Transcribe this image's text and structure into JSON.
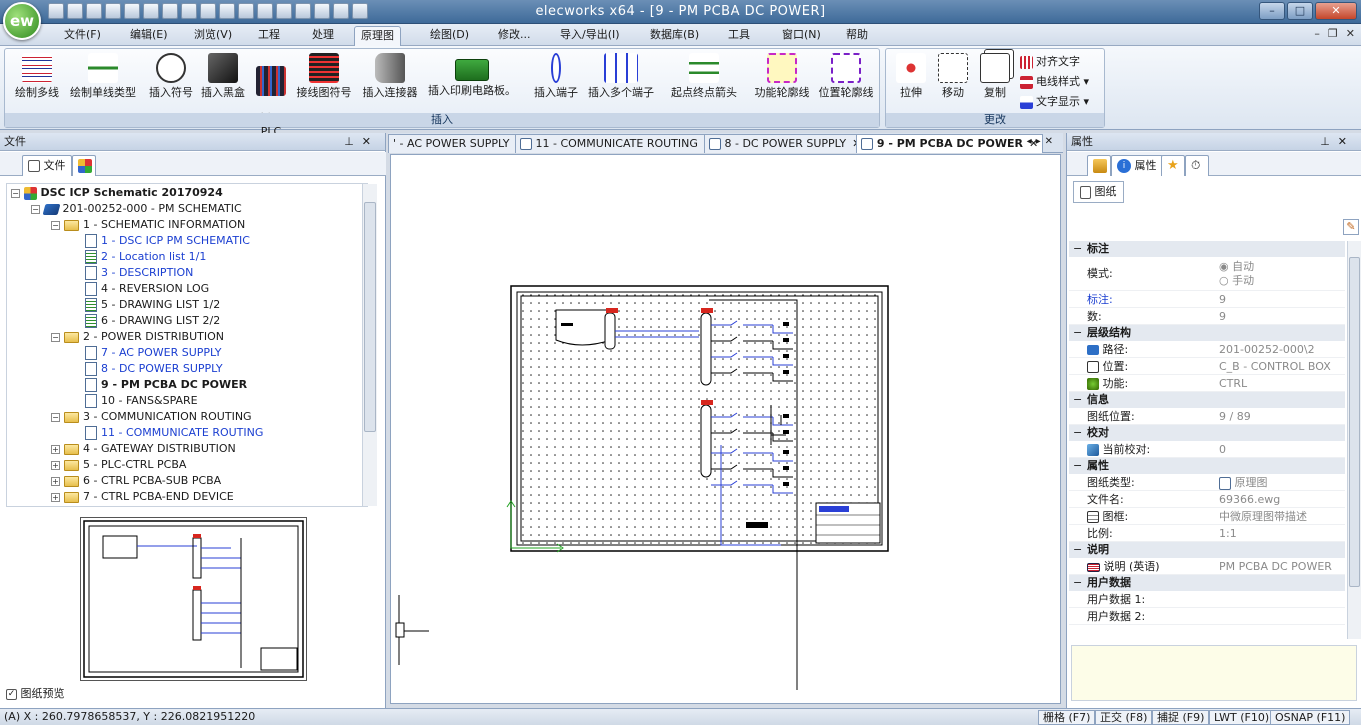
{
  "app": {
    "logo": "ew",
    "title": "elecworks x64 - [9 - PM PCBA DC POWER]"
  },
  "menu": [
    {
      "label": "文件(F)"
    },
    {
      "label": "编辑(E)"
    },
    {
      "label": "浏览(V)"
    },
    {
      "label": "工程"
    },
    {
      "label": "处理"
    },
    {
      "label": "原理图"
    },
    {
      "label": "绘图(D)"
    },
    {
      "label": "修改..."
    },
    {
      "label": "导入/导出(I)"
    },
    {
      "label": "数据库(B)"
    },
    {
      "label": "工具"
    },
    {
      "label": "窗口(N)"
    },
    {
      "label": "帮助"
    }
  ],
  "ribbon": {
    "insert_group": "插入",
    "modify_group": "更改",
    "buttons": [
      {
        "label": "绘制多线",
        "icon": "multiwire-icon"
      },
      {
        "label": "绘制单线类型",
        "icon": "single-wire-icon"
      },
      {
        "label": "插入符号",
        "icon": "motor-symbol-icon"
      },
      {
        "label": "插入黑盒",
        "icon": "black-box-icon"
      },
      {
        "label": "插入\nPLC",
        "icon": "plc-icon"
      },
      {
        "label": "接线图符号",
        "icon": "wiring-symbol-icon"
      },
      {
        "label": "插入连接器",
        "icon": "connector-icon"
      },
      {
        "label": "插入印刷电路板。",
        "icon": "pcb-icon"
      },
      {
        "label": "插入端子",
        "icon": "terminal-icon"
      },
      {
        "label": "插入多个端子",
        "icon": "multi-terminal-icon"
      },
      {
        "label": "起点终点箭头",
        "icon": "origin-destination-arrow-icon"
      },
      {
        "label": "功能轮廓线",
        "icon": "function-outline-icon"
      },
      {
        "label": "位置轮廓线",
        "icon": "location-outline-icon"
      },
      {
        "label": "拉伸",
        "icon": "stretch-icon"
      },
      {
        "label": "移动",
        "icon": "move-icon"
      },
      {
        "label": "复制",
        "icon": "copy-icon"
      }
    ],
    "small_buttons": [
      {
        "label": "对齐文字"
      },
      {
        "label": "电线样式"
      },
      {
        "label": "文字显示"
      }
    ]
  },
  "left_panel": {
    "title": "文件",
    "tab_label": "文件",
    "tree": [
      {
        "label": "DSC ICP Schematic 20170924",
        "style": "bold"
      },
      {
        "label": "201-00252-000 - PM SCHEMATIC"
      },
      {
        "label": "1 - SCHEMATIC INFORMATION"
      },
      {
        "label": "1 - DSC ICP PM SCHEMATIC",
        "style": "blue"
      },
      {
        "label": "2 - Location list 1/1",
        "style": "blue"
      },
      {
        "label": "3 - DESCRIPTION",
        "style": "blue"
      },
      {
        "label": "4 - REVERSION LOG"
      },
      {
        "label": "5 - DRAWING LIST 1/2"
      },
      {
        "label": "6 - DRAWING LIST 2/2"
      },
      {
        "label": "2 - POWER DISTRIBUTION"
      },
      {
        "label": "7 - AC POWER SUPPLY",
        "style": "blue"
      },
      {
        "label": "8 - DC POWER SUPPLY",
        "style": "blue"
      },
      {
        "label": "9 - PM PCBA DC POWER",
        "style": "bold"
      },
      {
        "label": "10 - FANS&SPARE"
      },
      {
        "label": "3 - COMMUNICATION ROUTING"
      },
      {
        "label": "11 - COMMUNICATE ROUTING",
        "style": "blue"
      },
      {
        "label": "4 - GATEWAY DISTRIBUTION"
      },
      {
        "label": "5 - PLC-CTRL PCBA"
      },
      {
        "label": "6 - CTRL PCBA-SUB PCBA"
      },
      {
        "label": "7 - CTRL PCBA-END DEVICE"
      }
    ],
    "preview_label": "图纸预览"
  },
  "doc_tabs": [
    {
      "label": "' - AC POWER SUPPLY"
    },
    {
      "label": "11 - COMMUNICATE ROUTING"
    },
    {
      "label": "8 - DC POWER SUPPLY"
    },
    {
      "label": "9 - PM PCBA DC POWER",
      "active": true
    }
  ],
  "right_panel": {
    "title": "属性",
    "tab_label": "属性",
    "sub_tab": "图纸",
    "categories": [
      {
        "name": "标注",
        "rows": [
          {
            "key": "模式:",
            "value": "",
            "options": [
              "自动",
              "手动"
            ]
          },
          {
            "key": "标注:",
            "value": "9",
            "key_style": "blue"
          },
          {
            "key": "数:",
            "value": "9"
          }
        ]
      },
      {
        "name": "层级结构",
        "rows": [
          {
            "key": "路径:",
            "value": "201-00252-000\\2"
          },
          {
            "key": "位置:",
            "value": "C_B - CONTROL BOX"
          },
          {
            "key": "功能:",
            "value": "CTRL"
          }
        ]
      },
      {
        "name": "信息",
        "rows": [
          {
            "key": "图纸位置:",
            "value": "9 / 89"
          }
        ]
      },
      {
        "name": "校对",
        "rows": [
          {
            "key": "当前校对:",
            "value": "0"
          }
        ]
      },
      {
        "name": "属性",
        "rows": [
          {
            "key": "图纸类型:",
            "value": "原理图"
          },
          {
            "key": "文件名:",
            "value": "69366.ewg"
          },
          {
            "key": "图框:",
            "value": "中微原理图带描述"
          },
          {
            "key": "比例:",
            "value": "1:1"
          }
        ]
      },
      {
        "name": "说明",
        "rows": [
          {
            "key": "说明 (英语)",
            "value": "PM PCBA DC POWER"
          }
        ]
      },
      {
        "name": "用户数据",
        "rows": [
          {
            "key": "用户数据 1:",
            "value": ""
          },
          {
            "key": "用户数据 2:",
            "value": ""
          }
        ]
      }
    ]
  },
  "status": {
    "coordinates": "(A) X : 260.7978658537, Y : 226.0821951220",
    "buttons": [
      {
        "label": "栅格 (F7)"
      },
      {
        "label": "正交 (F8)"
      },
      {
        "label": "捕捉 (F9)"
      },
      {
        "label": "LWT (F10)"
      },
      {
        "label": "OSNAP (F11)"
      }
    ]
  },
  "colors": {
    "titlebar": "#3e6a99",
    "accent": "#1b3fd1",
    "wire": "#2a3fd6",
    "marker": "#d7261e"
  }
}
